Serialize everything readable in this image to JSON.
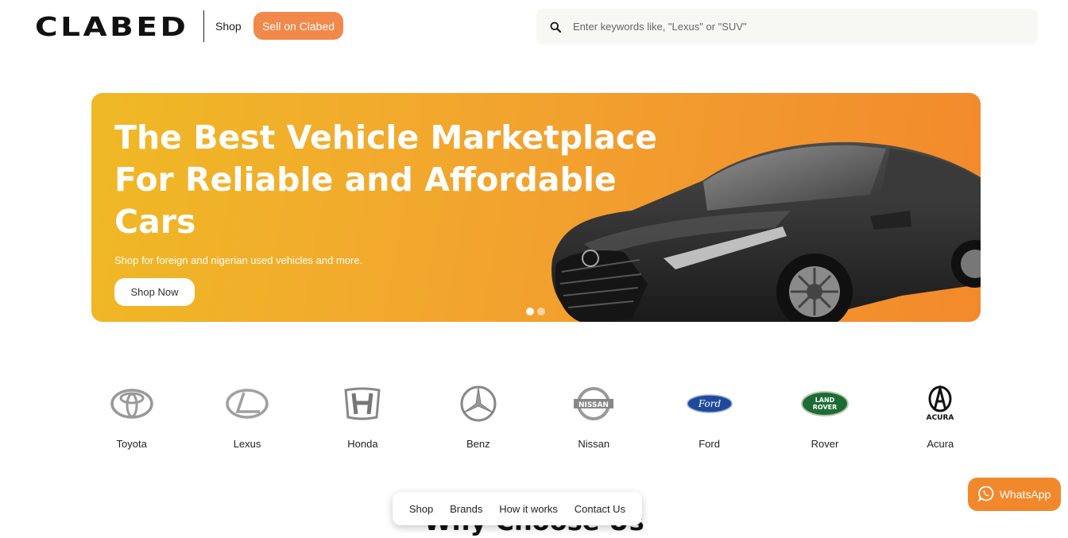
{
  "header": {
    "logo": "CLABED",
    "nav_shop": "Shop",
    "sell_button": "Sell on Clabed",
    "search_placeholder": "Enter keywords like, \"Lexus\" or \"SUV\""
  },
  "hero": {
    "title": "The Best Vehicle Marketplace For Reliable and Affordable Cars",
    "subtitle": "Shop for foreign and nigerian used vehicles and more.",
    "cta": "Shop Now",
    "slides": 2,
    "active_slide": 1
  },
  "brands": [
    {
      "name": "Toyota",
      "icon": "toyota-logo-icon"
    },
    {
      "name": "Lexus",
      "icon": "lexus-logo-icon"
    },
    {
      "name": "Honda",
      "icon": "honda-logo-icon"
    },
    {
      "name": "Benz",
      "icon": "mercedes-logo-icon"
    },
    {
      "name": "Nissan",
      "icon": "nissan-logo-icon"
    },
    {
      "name": "Ford",
      "icon": "ford-logo-icon"
    },
    {
      "name": "Rover",
      "icon": "land-rover-logo-icon"
    },
    {
      "name": "Acura",
      "icon": "acura-logo-icon"
    }
  ],
  "brand_logo_text": {
    "nissan": "NISSAN",
    "ford": "Ford",
    "rover_top": "LAND",
    "rover_bottom": "ROVER",
    "acura": "ACURA"
  },
  "section_title": "Why Choose Us",
  "floating_nav": [
    "Shop",
    "Brands",
    "How it works",
    "Contact Us"
  ],
  "whatsapp_label": "WhatsApp",
  "colors": {
    "accent": "#f2884a",
    "hero_start": "#efb925",
    "hero_end": "#f3892c",
    "whatsapp": "#f2882c"
  }
}
